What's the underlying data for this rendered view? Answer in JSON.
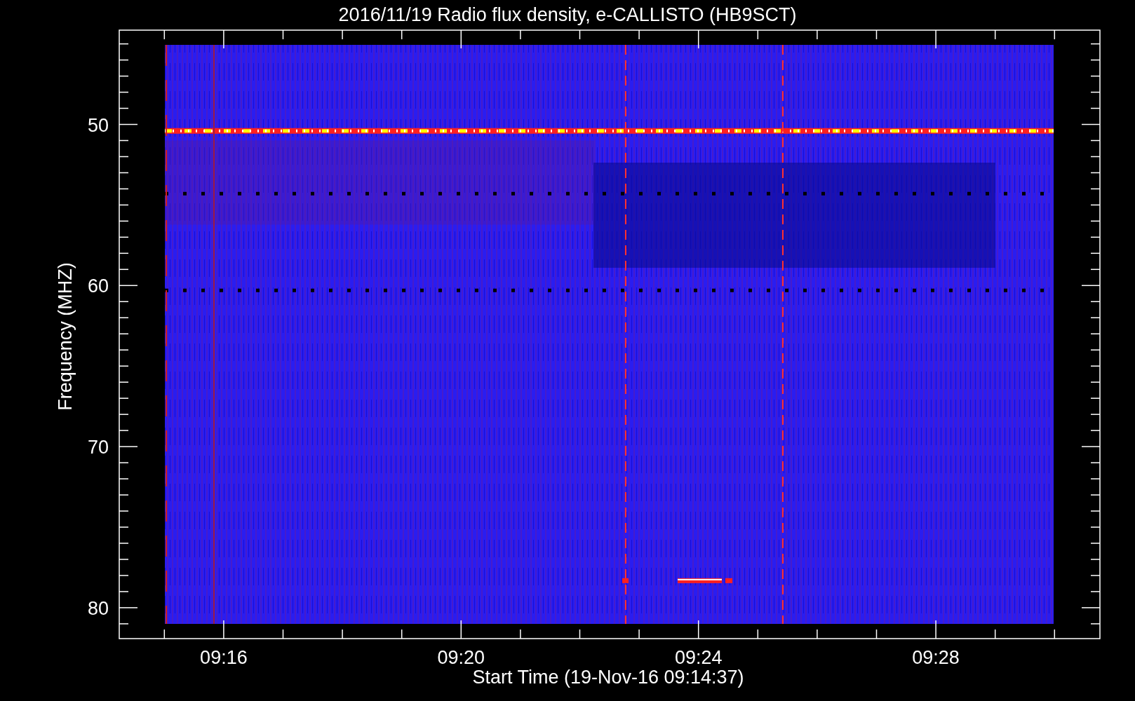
{
  "title": "2016/11/19  Radio flux density, e-CALLISTO (HB9SCT)",
  "x_axis": {
    "label": "Start Time (19-Nov-16 09:14:37)",
    "ticks": [
      "09:16",
      "09:20",
      "09:24",
      "09:28"
    ]
  },
  "y_axis": {
    "label": "Frequency (MHZ)",
    "ticks": [
      "50",
      "60",
      "70",
      "80"
    ]
  }
}
